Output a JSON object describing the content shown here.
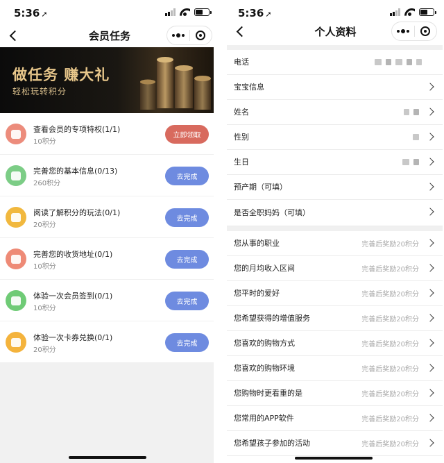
{
  "left": {
    "status": {
      "time": "5:36",
      "arrow": "➚"
    },
    "nav": {
      "title": "会员任务"
    },
    "banner": {
      "headline": "做任务 赚大礼",
      "subline": "轻松玩转积分"
    },
    "tasks": [
      {
        "name": "查看会员的专项特权(1/1)",
        "points": "10积分",
        "button": "立即领取",
        "icon": "diamond-icon",
        "icon_color": "#ec8c7c",
        "button_color": "#d86a5e"
      },
      {
        "name": "完善您的基本信息(0/13)",
        "points": "260积分",
        "button": "去完成",
        "icon": "form-icon",
        "icon_color": "#7ccd86",
        "button_color": "#6e8be0"
      },
      {
        "name": "阅读了解积分的玩法(0/1)",
        "points": "20积分",
        "button": "去完成",
        "icon": "piggy-bank-icon",
        "icon_color": "#f1b83e",
        "button_color": "#6e8be0"
      },
      {
        "name": "完善您的收货地址(0/1)",
        "points": "10积分",
        "button": "去完成",
        "icon": "edit-icon",
        "icon_color": "#ee8a76",
        "button_color": "#6e8be0"
      },
      {
        "name": "体验一次会员签到(0/1)",
        "points": "10积分",
        "button": "去完成",
        "icon": "calendar-icon",
        "icon_color": "#6fcb76",
        "button_color": "#6e8be0"
      },
      {
        "name": "体验一次卡券兑换(0/1)",
        "points": "20积分",
        "button": "去完成",
        "icon": "coupon-icon",
        "icon_color": "#f4b33c",
        "button_color": "#6e8be0"
      }
    ]
  },
  "right": {
    "status": {
      "time": "5:36",
      "arrow": "➚"
    },
    "nav": {
      "title": "个人资料"
    },
    "basic_rows": [
      {
        "label": "电话",
        "value": "",
        "chevron": false,
        "blur": [
          10,
          8,
          10,
          8,
          8
        ]
      },
      {
        "label": "宝宝信息",
        "value": "",
        "chevron": true,
        "blur": []
      },
      {
        "label": "姓名",
        "value": "",
        "chevron": true,
        "blur": [
          8,
          8
        ]
      },
      {
        "label": "性别",
        "value": "",
        "chevron": true,
        "blur": [
          9
        ]
      },
      {
        "label": "生日",
        "value": "",
        "chevron": true,
        "blur": [
          10,
          8
        ]
      },
      {
        "label": "预产期（可填）",
        "value": "",
        "chevron": true,
        "blur": []
      },
      {
        "label": "是否全职妈妈（可填）",
        "value": "",
        "chevron": true,
        "blur": []
      }
    ],
    "extra_rows": [
      {
        "label": "您从事的职业",
        "value": "完善后奖励20积分"
      },
      {
        "label": "您的月均收入区间",
        "value": "完善后奖励20积分"
      },
      {
        "label": "您平时的爱好",
        "value": "完善后奖励20积分"
      },
      {
        "label": "您希望获得的增值服务",
        "value": "完善后奖励20积分"
      },
      {
        "label": "您喜欢的购物方式",
        "value": "完善后奖励20积分"
      },
      {
        "label": "您喜欢的购物环境",
        "value": "完善后奖励20积分"
      },
      {
        "label": "您购物时更看重的是",
        "value": "完善后奖励20积分"
      },
      {
        "label": "您常用的APP软件",
        "value": "完善后奖励20积分"
      },
      {
        "label": "您希望孩子参加的活动",
        "value": "完善后奖励20积分"
      }
    ]
  }
}
